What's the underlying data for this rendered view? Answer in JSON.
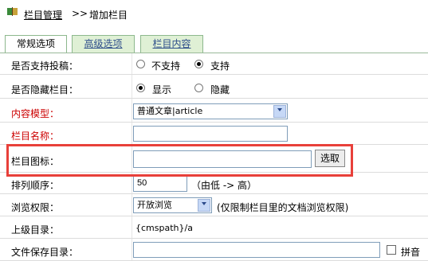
{
  "header": {
    "link": "栏目管理",
    "sep": ">>",
    "current": "增加栏目"
  },
  "tabs": [
    {
      "label": "常规选项"
    },
    {
      "label": "高级选项"
    },
    {
      "label": "栏目内容"
    }
  ],
  "form": {
    "allow_submit": {
      "label": "是否支持投稿：",
      "opt_no": "不支持",
      "opt_yes": "支持"
    },
    "hidden": {
      "label": "是否隐藏栏目：",
      "opt_show": "显示",
      "opt_hide": "隐藏"
    },
    "content_model": {
      "label": "内容模型：",
      "value": "普通文章|article"
    },
    "category_name": {
      "label": "栏目名称：",
      "value": ""
    },
    "category_icon": {
      "label": "栏目图标：",
      "value": "",
      "button": "选取"
    },
    "sort_order": {
      "label": "排列顺序：",
      "value": "50",
      "hint": "（由低 -> 高）"
    },
    "browse_permission": {
      "label": "浏览权限：",
      "value": "开放浏览",
      "hint": "(仅限制栏目里的文档浏览权限)"
    },
    "parent_dir": {
      "label": "上级目录：",
      "value": "{cmspath}/a"
    },
    "save_dir": {
      "label": "文件保存目录：",
      "value": "",
      "checkbox_label": "拼音"
    }
  }
}
